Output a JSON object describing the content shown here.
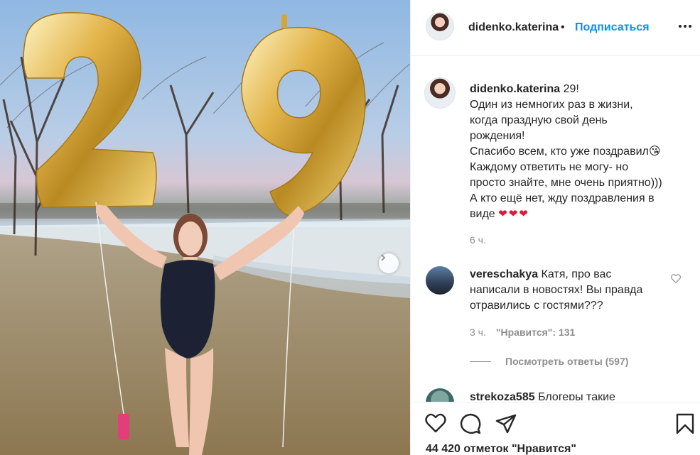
{
  "post": {
    "photo_alt": "Фото пользователя didenko.katerina",
    "balloon_digits": [
      "2",
      "9"
    ]
  },
  "header": {
    "username": "didenko.katerina",
    "separator": "•",
    "follow_label": "Подписаться"
  },
  "caption": {
    "username": "didenko.katerina",
    "first": "29!",
    "lines": [
      "Один из немногих раз в жизни,",
      "когда праздную свой день",
      "рождения!",
      "Спасибо всем, кто уже поздравил😘",
      "Каждому ответить не могу- но",
      "просто знайте, мне очень приятно)))",
      "А кто ещё нет, жду поздравления в",
      "виде"
    ],
    "hearts": "❤❤❤",
    "time": "6 ч."
  },
  "comments": [
    {
      "username": "vereschakya",
      "first": "Катя, про вас",
      "lines": [
        "написали в новостях! Вы правда",
        "отравились с гостями???"
      ],
      "time": "3 ч.",
      "likes": "\"Нравится\": 131",
      "replies": "Посмотреть ответы (597)"
    },
    {
      "username": "strekoza585",
      "text": "Блогеры такие"
    }
  ],
  "footer": {
    "likes": "44 420 отметок \"Нравится\""
  },
  "colors": {
    "accent": "#0095f6",
    "text": "#262626",
    "secondary": "#8e8e8e",
    "heart": "#d81b3a"
  }
}
